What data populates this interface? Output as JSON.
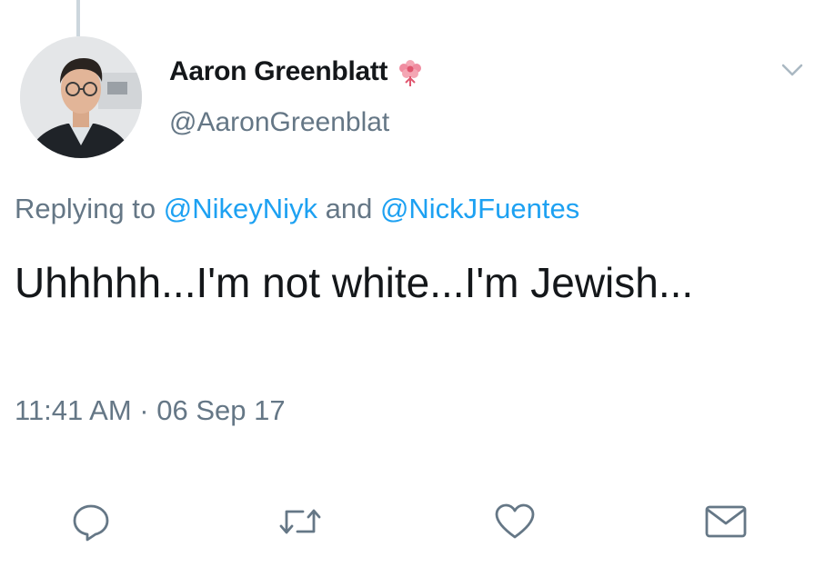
{
  "author": {
    "display_name": "Aaron Greenblatt",
    "handle": "@AaronGreenblat",
    "avatar_icon": "profile-photo",
    "badge_icon": "flower-icon"
  },
  "reply": {
    "prefix": "Replying to ",
    "mention_1": "@NikeyNiyk",
    "joiner": " and ",
    "mention_2": "@NickJFuentes"
  },
  "tweet": {
    "text": "Uhhhhh...I'm not white...I'm Jewish...",
    "timestamp": "11:41 AM · 06 Sep 17"
  },
  "actions": [
    {
      "icon": "reply-icon"
    },
    {
      "icon": "retweet-icon"
    },
    {
      "icon": "like-icon"
    },
    {
      "icon": "share-dm-icon"
    }
  ],
  "colors": {
    "text": "#14171a",
    "secondary": "#657786",
    "link": "#1da1f2",
    "icon": "#657786"
  }
}
